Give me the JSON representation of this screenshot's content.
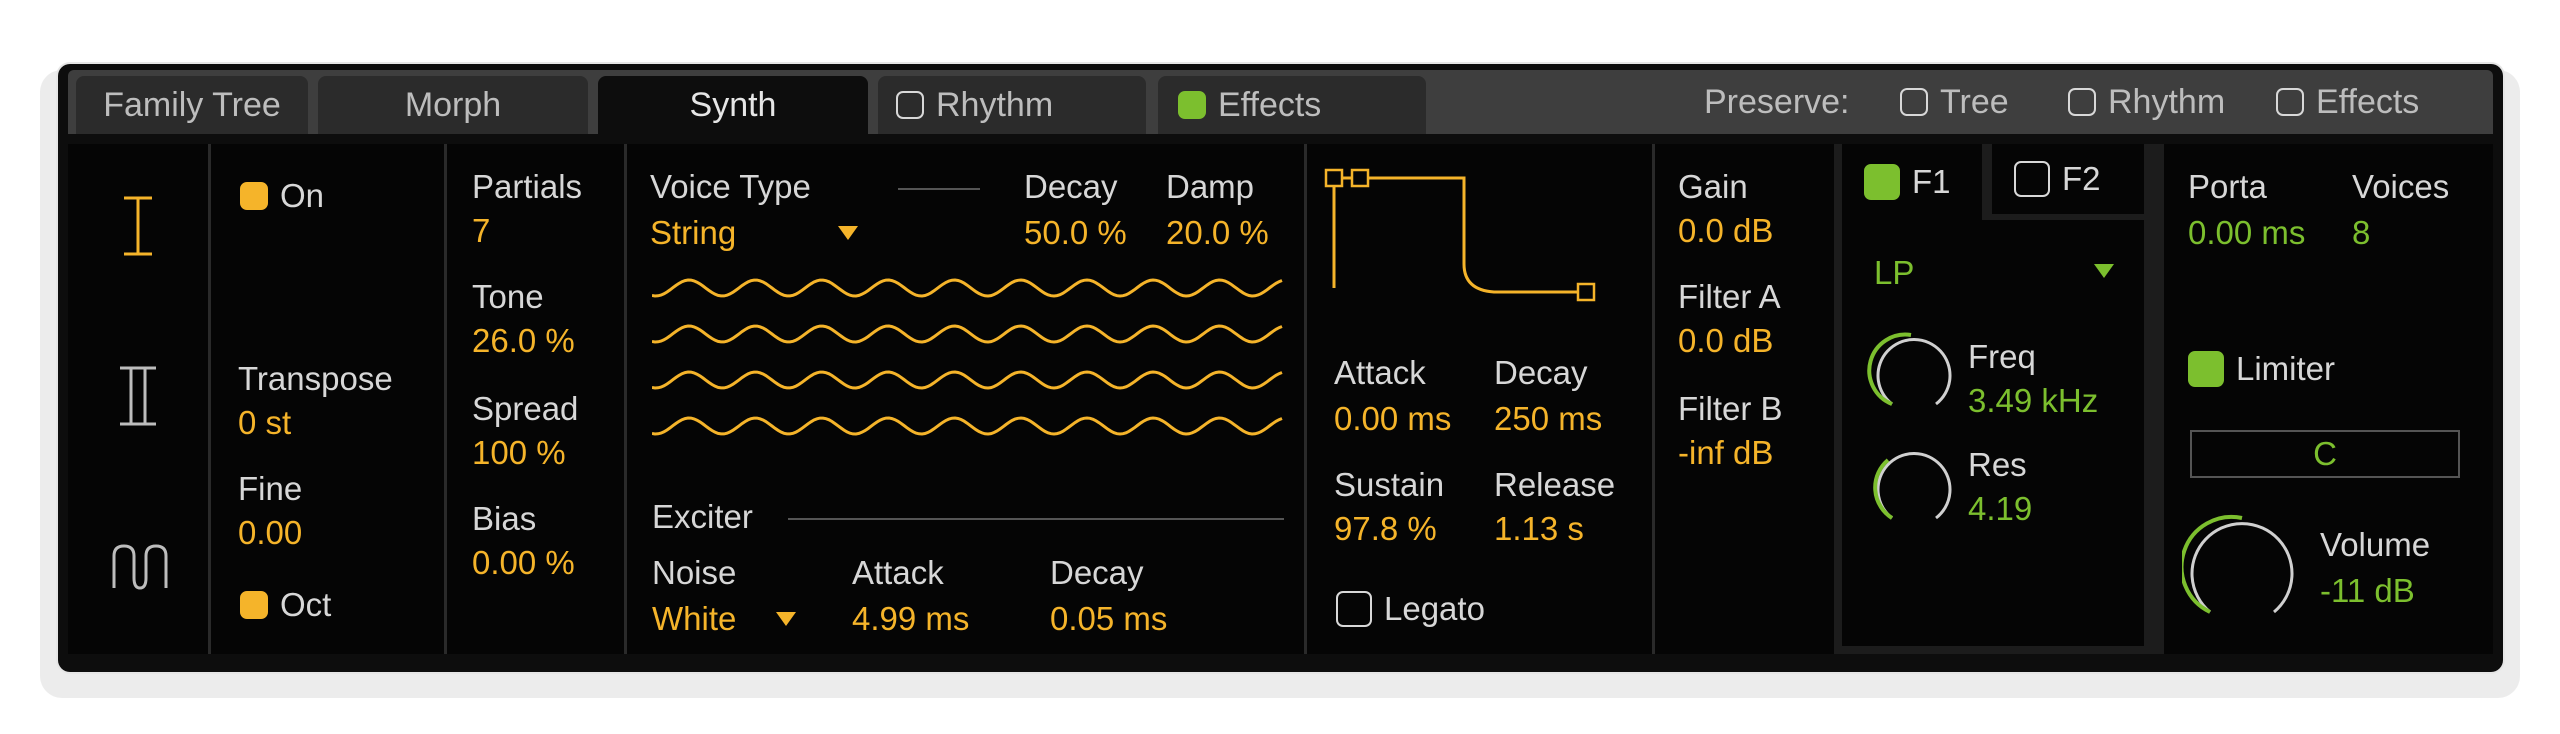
{
  "tabs": {
    "family_tree": "Family Tree",
    "morph": "Morph",
    "synth": "Synth",
    "rhythm": "Rhythm",
    "effects": "Effects"
  },
  "preserve": {
    "label": "Preserve:",
    "tree": "Tree",
    "rhythm": "Rhythm",
    "effects": "Effects"
  },
  "osc": {
    "on": "On",
    "transpose_label": "Transpose",
    "transpose_value": "0 st",
    "fine_label": "Fine",
    "fine_value": "0.00",
    "oct": "Oct"
  },
  "partials": {
    "partials_label": "Partials",
    "partials_value": "7",
    "tone_label": "Tone",
    "tone_value": "26.0 %",
    "spread_label": "Spread",
    "spread_value": "100 %",
    "bias_label": "Bias",
    "bias_value": "0.00 %"
  },
  "voice": {
    "voice_type_label": "Voice Type",
    "voice_type_value": "String",
    "decay_label": "Decay",
    "decay_value": "50.0 %",
    "damp_label": "Damp",
    "damp_value": "20.0 %",
    "exciter_label": "Exciter",
    "noise_label": "Noise",
    "noise_value": "White",
    "attack_label": "Attack",
    "attack_value": "4.99 ms",
    "exc_decay_label": "Decay",
    "exc_decay_value": "0.05 ms"
  },
  "envelope": {
    "attack_label": "Attack",
    "attack_value": "0.00 ms",
    "decay_label": "Decay",
    "decay_value": "250 ms",
    "sustain_label": "Sustain",
    "sustain_value": "97.8 %",
    "release_label": "Release",
    "release_value": "1.13 s",
    "legato": "Legato"
  },
  "gain": {
    "gain_label": "Gain",
    "gain_value": "0.0 dB",
    "filter_a_label": "Filter A",
    "filter_a_value": "0.0 dB",
    "filter_b_label": "Filter B",
    "filter_b_value": "-inf dB"
  },
  "filter": {
    "f1": "F1",
    "f2": "F2",
    "type": "LP",
    "freq_label": "Freq",
    "freq_value": "3.49 kHz",
    "res_label": "Res",
    "res_value": "4.19"
  },
  "global": {
    "porta_label": "Porta",
    "porta_value": "0.00 ms",
    "voices_label": "Voices",
    "voices_value": "8",
    "limiter": "Limiter",
    "key": "C",
    "volume_label": "Volume",
    "volume_value": "-11 dB"
  },
  "colors": {
    "accent_yellow": "#f5b42a",
    "accent_green": "#7cbf2e"
  }
}
